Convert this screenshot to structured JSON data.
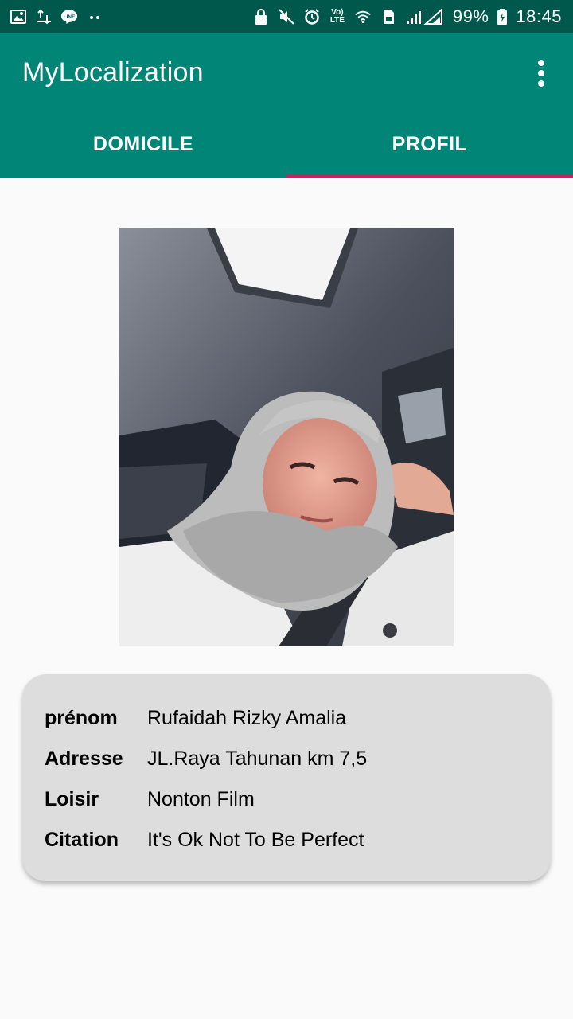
{
  "status_bar": {
    "battery": "99%",
    "time": "18:45",
    "lte_top": "Vo)",
    "lte_bottom": "LTE",
    "line_label": "LINE",
    "icons": [
      "gallery-icon",
      "transfer-icon",
      "line-app-icon",
      "more-dots-icon",
      "lock-icon",
      "mute-icon",
      "alarm-icon",
      "volte-icon",
      "wifi-icon",
      "sim-icon",
      "signal-icon",
      "battery-icon"
    ]
  },
  "app_bar": {
    "title": "MyLocalization",
    "menu_icon": "overflow-menu-icon"
  },
  "tabs": [
    {
      "label": "DOMICILE",
      "selected": false
    },
    {
      "label": "PROFIL",
      "selected": true
    }
  ],
  "colors": {
    "status_bar": "#00574b",
    "primary": "#008577",
    "accent": "#d81b60",
    "card": "#dddddd",
    "background": "#fafafa"
  },
  "profile": {
    "photo": "profile-photo",
    "rows": [
      {
        "label": "prénom",
        "value": "Rufaidah Rizky Amalia"
      },
      {
        "label": "Adresse",
        "value": "JL.Raya Tahunan km 7,5"
      },
      {
        "label": "Loisir",
        "value": "Nonton Film"
      },
      {
        "label": "Citation",
        "value": "It's Ok Not To Be Perfect"
      }
    ]
  }
}
